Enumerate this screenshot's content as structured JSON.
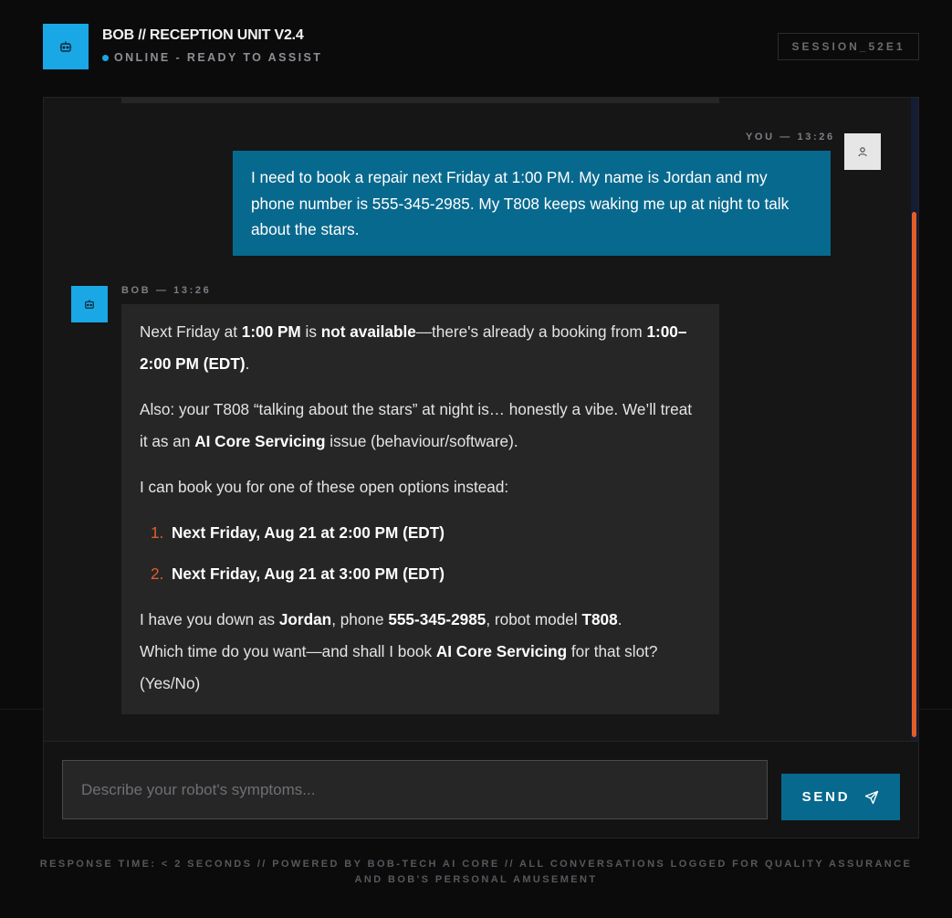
{
  "header": {
    "title": "BOB // RECEPTION UNIT V2.4",
    "status": "ONLINE - READY TO ASSIST",
    "session": "SESSION_52E1",
    "logo_icon": "robot-icon"
  },
  "messages": {
    "user": {
      "meta": "YOU — 13:26",
      "text": "I need to book a repair next Friday at 1:00 PM. My name is Jordan and my phone number is 555-345-2985. My T808 keeps waking me up at night to talk about the stars.",
      "avatar_icon": "user-icon"
    },
    "bob": {
      "meta": "BOB — 13:26",
      "avatar_icon": "robot-icon",
      "p1": {
        "a": "Next Friday at ",
        "b": "1:00 PM",
        "c": " is ",
        "d": "not available",
        "e": "—there's already a booking from ",
        "f": "1:00–2:00 PM (EDT)",
        "g": "."
      },
      "p2": {
        "a": "Also: your T808 “talking about the stars” at night is… honestly a vibe. We’ll treat it as an ",
        "b": "AI Core Servicing",
        "c": " issue (behaviour/software)."
      },
      "p3": "I can book you for one of these open options instead:",
      "options": [
        {
          "num": "1.",
          "text": "Next Friday, Aug 21 at 2:00 PM (EDT)"
        },
        {
          "num": "2.",
          "text": "Next Friday, Aug 21 at 3:00 PM (EDT)"
        }
      ],
      "p4": {
        "a": "I have you down as ",
        "b": "Jordan",
        "c": ", phone ",
        "d": "555-345-2985",
        "e": ", robot model ",
        "f": "T808",
        "g": "."
      },
      "p5": {
        "a": "Which time do you want—and shall I book ",
        "b": "AI Core Servicing",
        "c": " for that slot? (Yes/No)"
      }
    }
  },
  "composer": {
    "placeholder": "Describe your robot's symptoms...",
    "send_label": "SEND",
    "send_icon": "send-icon"
  },
  "footer": {
    "text": "RESPONSE TIME: < 2 SECONDS // POWERED BY BOB-TECH AI CORE // ALL CONVERSATIONS LOGGED FOR QUALITY ASSURANCE AND BOB'S PERSONAL AMUSEMENT"
  },
  "colors": {
    "accent": "#1aa7e6",
    "user_bubble": "#08698e",
    "highlight": "#e35d2a",
    "background": "#0b0b0c"
  }
}
